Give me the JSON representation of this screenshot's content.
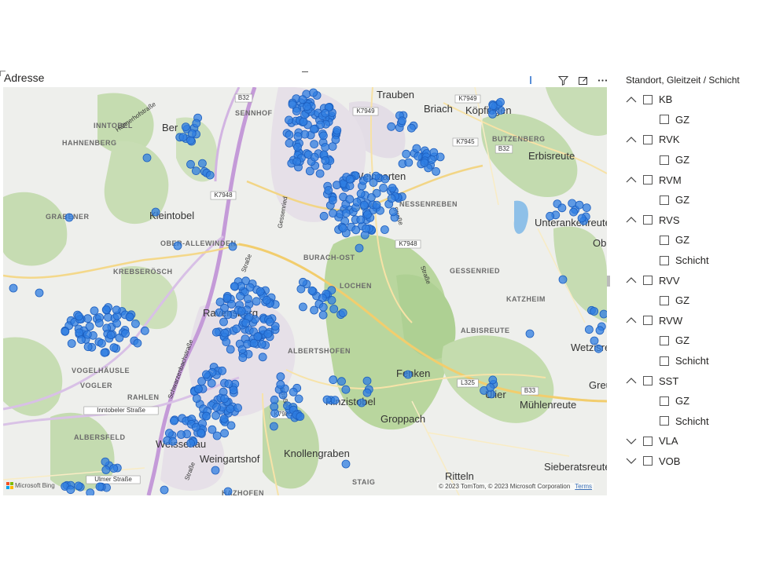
{
  "visual": {
    "title": "Adresse",
    "header_icons": [
      "filter-icon",
      "focus-mode-icon",
      "more-options-icon"
    ]
  },
  "map": {
    "places": [
      {
        "name": "Trauben",
        "style": "big"
      },
      {
        "name": "Briach",
        "style": "big"
      },
      {
        "name": "Köpfingen",
        "style": "big"
      },
      {
        "name": "INNTOBEL",
        "style": "cap"
      },
      {
        "name": "SENNHOF",
        "style": "cap"
      },
      {
        "name": "HAHNENBERG",
        "style": "cap"
      },
      {
        "name": "Ber",
        "style": "big"
      },
      {
        "name": "BUTZENBERG",
        "style": "cap"
      },
      {
        "name": "Erbisreute",
        "style": "big"
      },
      {
        "name": "Weingarten",
        "style": "big"
      },
      {
        "name": "NESSENREBEN",
        "style": "cap"
      },
      {
        "name": "GRABENER",
        "style": "cap"
      },
      {
        "name": "Kleintobel",
        "style": "big"
      },
      {
        "name": "Unterankenreute",
        "style": "big"
      },
      {
        "name": "OBER-ALLEWINDEN",
        "style": "cap"
      },
      {
        "name": "BURACH-OST",
        "style": "cap"
      },
      {
        "name": "Ob",
        "style": "big"
      },
      {
        "name": "KREBSERÖSCH",
        "style": "cap"
      },
      {
        "name": "GESSENRIED",
        "style": "cap"
      },
      {
        "name": "LOCHEN",
        "style": "cap"
      },
      {
        "name": "KATZHEIM",
        "style": "cap"
      },
      {
        "name": "Ravensburg",
        "style": "big"
      },
      {
        "name": "ALBISREUTE",
        "style": "cap"
      },
      {
        "name": "ALBERTSHOFEN",
        "style": "cap"
      },
      {
        "name": "Wetzisreute",
        "style": "big"
      },
      {
        "name": "VOGELHÄUSLE",
        "style": "cap"
      },
      {
        "name": "Fenken",
        "style": "big"
      },
      {
        "name": "VOGLER",
        "style": "cap"
      },
      {
        "name": "Greut",
        "style": "big"
      },
      {
        "name": "RAHLEN",
        "style": "cap"
      },
      {
        "name": "Hinzistobel",
        "style": "big"
      },
      {
        "name": "Ulier",
        "style": "big"
      },
      {
        "name": "Mühlenreute",
        "style": "big"
      },
      {
        "name": "Groppach",
        "style": "big"
      },
      {
        "name": "ALBERSFELD",
        "style": "cap"
      },
      {
        "name": "Weissenau",
        "style": "big"
      },
      {
        "name": "Knollengraben",
        "style": "big"
      },
      {
        "name": "Weingartshof",
        "style": "big"
      },
      {
        "name": "Sieberatsreute",
        "style": "big"
      },
      {
        "name": "Ritteln",
        "style": "big"
      },
      {
        "name": "STAIG",
        "style": "cap"
      },
      {
        "name": "HAZHOFEN",
        "style": "cap"
      }
    ],
    "roads": [
      "B32",
      "K7949",
      "K7949",
      "K7945",
      "B32",
      "K7948",
      "K7948",
      "L325",
      "B33",
      "K7980",
      "Inntobeler Straße",
      "Ulmer Straße",
      "Hühnerhofstraße",
      "Straße",
      "Gessenried",
      "Straße",
      "Straße",
      "Straße",
      "Schwarzenbachstraße",
      "Straße"
    ],
    "marker_color": "#2f7de1",
    "attribution": "© 2023 TomTom, © 2023 Microsoft Corporation",
    "terms": "Terms",
    "logo_text": "Microsoft Bing"
  },
  "slicer": {
    "title": "Standort, Gleitzeit / Schicht",
    "items": [
      {
        "label": "KB",
        "level": 1,
        "expander": "up"
      },
      {
        "label": "GZ",
        "level": 2
      },
      {
        "label": "RVK",
        "level": 1,
        "expander": "up"
      },
      {
        "label": "GZ",
        "level": 2
      },
      {
        "label": "RVM",
        "level": 1,
        "expander": "up"
      },
      {
        "label": "GZ",
        "level": 2
      },
      {
        "label": "RVS",
        "level": 1,
        "expander": "up"
      },
      {
        "label": "GZ",
        "level": 2
      },
      {
        "label": "Schicht",
        "level": 2
      },
      {
        "label": "RVV",
        "level": 1,
        "expander": "up"
      },
      {
        "label": "GZ",
        "level": 2
      },
      {
        "label": "RVW",
        "level": 1,
        "expander": "up"
      },
      {
        "label": "GZ",
        "level": 2
      },
      {
        "label": "Schicht",
        "level": 2
      },
      {
        "label": "SST",
        "level": 1,
        "expander": "up"
      },
      {
        "label": "GZ",
        "level": 2
      },
      {
        "label": "Schicht",
        "level": 2
      },
      {
        "label": "VLA",
        "level": 1,
        "expander": "down"
      },
      {
        "label": "VOB",
        "level": 1,
        "expander": "down"
      }
    ]
  }
}
